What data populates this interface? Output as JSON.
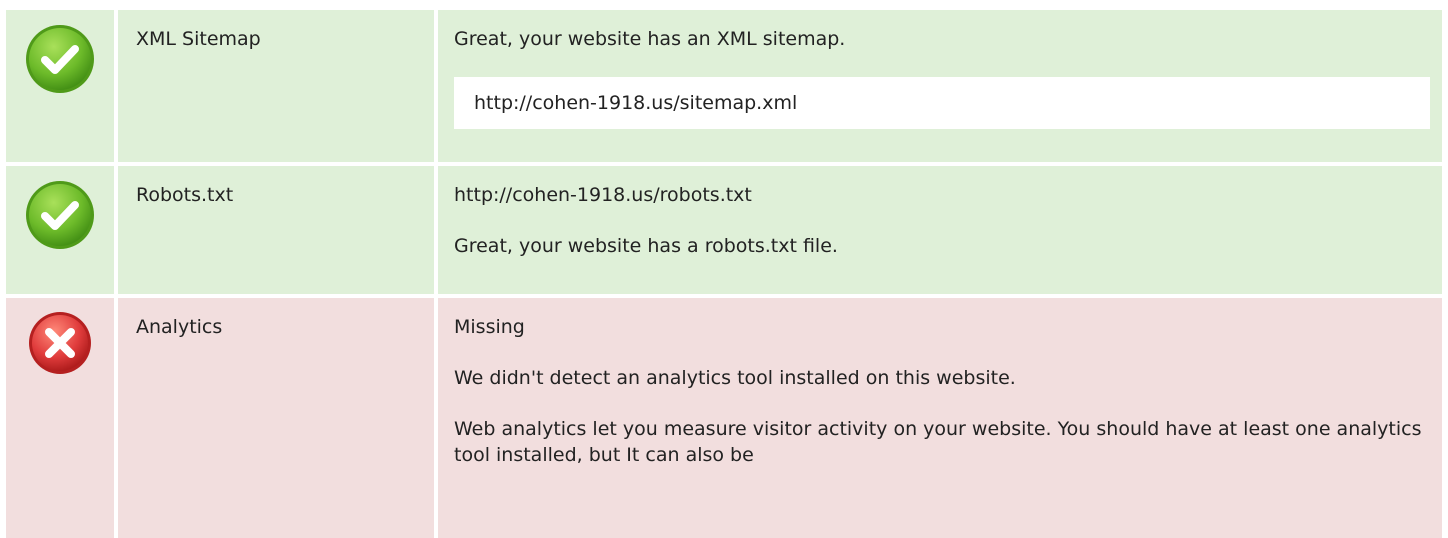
{
  "rows": [
    {
      "status": "pass",
      "icon": "check-circle-icon",
      "name": "XML Sitemap",
      "message": "Great, your website has an XML sitemap.",
      "url": "http://cohen-1918.us/sitemap.xml"
    },
    {
      "status": "pass",
      "icon": "check-circle-icon",
      "name": "Robots.txt",
      "url": "http://cohen-1918.us/robots.txt",
      "message": "Great, your website has a robots.txt file."
    },
    {
      "status": "fail",
      "icon": "error-circle-icon",
      "name": "Analytics",
      "state": "Missing",
      "message": "We didn't detect an analytics tool installed on this website.",
      "details": "Web analytics let you measure visitor activity on your website. You should have at least one analytics tool installed, but It can also be"
    }
  ],
  "colors": {
    "pass_bg": "#dff0d8",
    "fail_bg": "#f2dede",
    "pass_icon": "#6dbb2a",
    "fail_icon": "#e03c3c"
  }
}
